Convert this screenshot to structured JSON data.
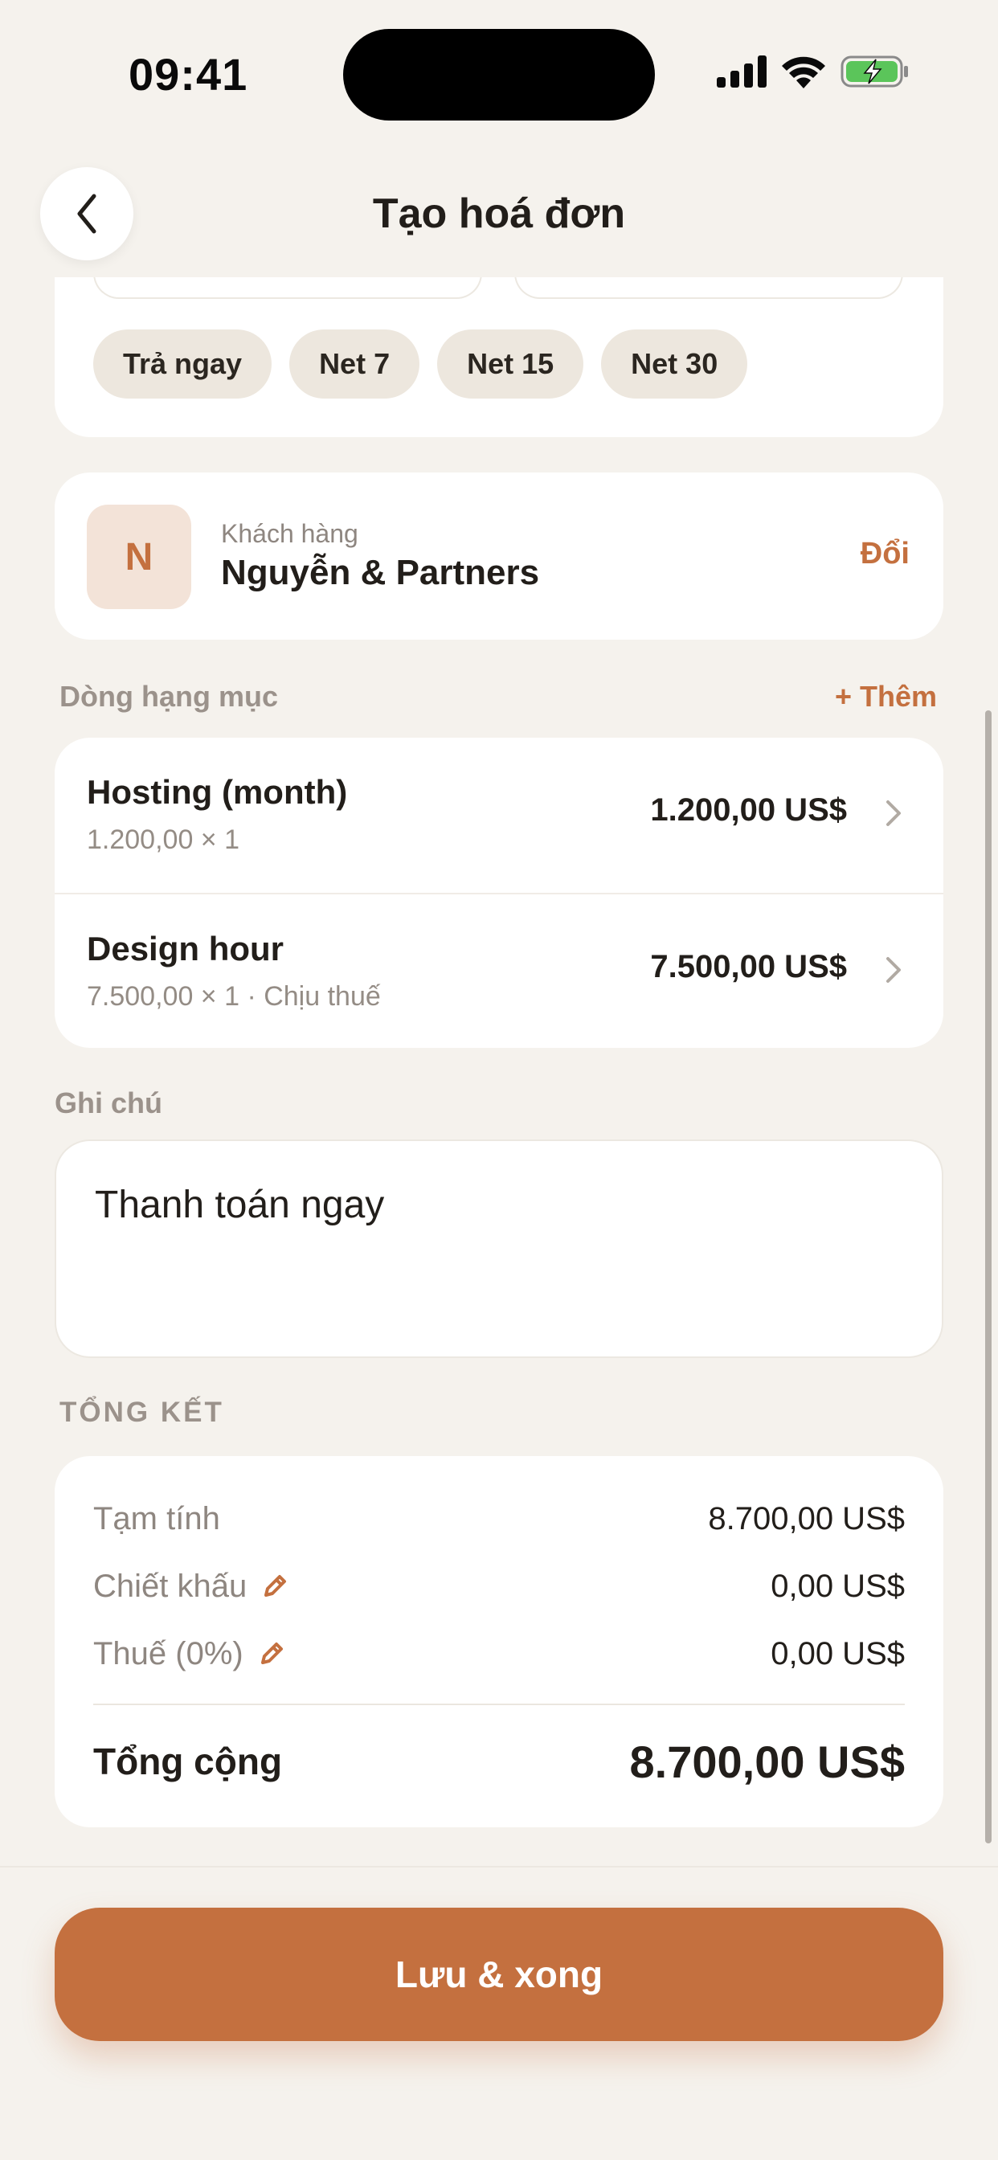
{
  "status_bar": {
    "time": "09:41"
  },
  "header": {
    "title": "Tạo hoá đơn"
  },
  "payment_terms": {
    "chips": [
      "Trả ngay",
      "Net 7",
      "Net 15",
      "Net 30"
    ]
  },
  "client": {
    "initial": "N",
    "label": "Khách hàng",
    "name": "Nguyễn & Partners",
    "change_label": "Đổi"
  },
  "line_items": {
    "section_label": "Dòng hạng mục",
    "add_label": "+ Thêm",
    "items": [
      {
        "name": "Hosting (month)",
        "detail": "1.200,00 × 1",
        "amount": "1.200,00 US$"
      },
      {
        "name": "Design hour",
        "detail": "7.500,00 × 1 · Chịu thuế",
        "amount": "7.500,00 US$"
      }
    ]
  },
  "notes": {
    "label": "Ghi chú",
    "value": "Thanh toán ngay"
  },
  "summary": {
    "section_label": "TỔNG KẾT",
    "subtotal_label": "Tạm tính",
    "subtotal_value": "8.700,00 US$",
    "discount_label": "Chiết khấu",
    "discount_value": "0,00 US$",
    "tax_label": "Thuế (0%)",
    "tax_value": "0,00 US$",
    "total_label": "Tổng cộng",
    "total_value": "8.700,00 US$"
  },
  "footer": {
    "save_label": "Lưu & xong"
  },
  "colors": {
    "accent": "#c4703f",
    "background": "#f5f2ed",
    "card": "#ffffff",
    "chip": "#ede7de",
    "battery": "#5bc55a"
  },
  "icons": [
    "back-chevron-icon",
    "signal-icon",
    "wifi-icon",
    "battery-charging-icon",
    "chevron-right-icon",
    "pencil-icon"
  ]
}
